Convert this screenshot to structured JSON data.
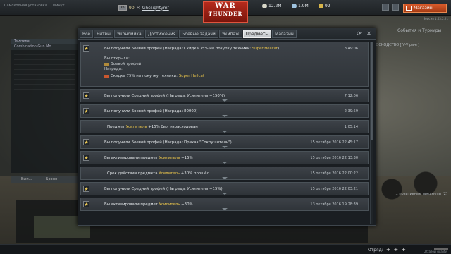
{
  "topbar": {
    "left_info": "Самоходная установка ... Минут ...",
    "player_flag": "XA",
    "player_level": "90",
    "player_name": "Ghcsightymf",
    "logo_line1": "WAR",
    "logo_line2": "THUNDER",
    "silver_lions": "12.2M",
    "research": "1.9M",
    "golden_eagles": "92",
    "store_label": "Магазин",
    "version": "Версия 1.63.2.21"
  },
  "background": {
    "left_panel_title": "Техника",
    "left_panel_sub": "Combination Gun Mo...",
    "left_panel_bottom": "Вып...",
    "left_panel_bottom2": "Броня",
    "right_panel_title": "События и Турниры",
    "right_panel_line": "ВОСКОДСТВО",
    "right_panel_mode": "[IV-V ранг]",
    "right_panel_bottom": "... позитивные предметы (2)"
  },
  "window": {
    "tabs": [
      {
        "label": "Все",
        "active": false
      },
      {
        "label": "Битвы",
        "active": false
      },
      {
        "label": "Экономика",
        "active": false
      },
      {
        "label": "Достижения",
        "active": false
      },
      {
        "label": "Боевые задачи",
        "active": false
      },
      {
        "label": "Экипаж",
        "active": false
      },
      {
        "label": "Предметы",
        "active": true
      },
      {
        "label": "Магазин",
        "active": false
      }
    ],
    "refresh_icon": "refresh-icon",
    "close_icon": "close-icon",
    "rows": [
      {
        "star": true,
        "text_pre": "Вы получили Боевой трофей (Награда: Скидка 75% на покупку техники: ",
        "text_hl": "Super Hellcat",
        "text_post": ")",
        "time": "8:49:06",
        "expanded": true,
        "details": {
          "opened_label": "Вы открыли:",
          "opened_item": "Боевой трофей",
          "reward_label": "Награда:",
          "reward_text": "Скидка 75% на покупку техники: ",
          "reward_hl": "Super Hellcat"
        }
      },
      {
        "star": true,
        "text_pre": "Вы получили Средний трофей (Награда: Усилитель +150%",
        "text_hl": "",
        "text_post": ")",
        "time": "7:12:06",
        "expanded": false
      },
      {
        "star": true,
        "text_pre": "Вы получили Боевой трофей (Награда: 80000",
        "text_hl": "",
        "text_post": ")",
        "time": "2:39:59",
        "expanded": false
      },
      {
        "star": false,
        "text_pre": "Предмет ",
        "text_hl": "Усилитель",
        "text_post": " +15% был израсходован",
        "time": "1:05:14",
        "expanded": false
      },
      {
        "star": true,
        "text_pre": "Вы получили Боевой трофей (Награда: Приказ \"Сокрушитель\")",
        "text_hl": "",
        "text_post": "",
        "time": "15 октября 2016 22:45:17",
        "expanded": false
      },
      {
        "star": true,
        "text_pre": "Вы активировали предмет ",
        "text_hl": "Усилитель",
        "text_post": " +15%",
        "time": "15 октября 2016 22:13:30",
        "expanded": false
      },
      {
        "star": false,
        "text_pre": "Срок действия предмета ",
        "text_hl": "Усилитель",
        "text_post": " +30% прошёл",
        "time": "15 октября 2016 22:00:22",
        "expanded": false
      },
      {
        "star": true,
        "text_pre": "Вы получили Средний трофей (Награда: Усилитель +15%",
        "text_hl": "",
        "text_post": ")",
        "time": "15 октября 2016 22:03:21",
        "expanded": false
      },
      {
        "star": true,
        "text_pre": "Вы активировали предмет ",
        "text_hl": "Усилитель",
        "text_post": " +30%",
        "time": "13 октября 2016 19:28:39",
        "expanded": false
      }
    ]
  },
  "bottombar": {
    "squad_label": "Отряд:",
    "quality_label": "Ultra low quality"
  },
  "colors": {
    "highlight": "#e8c34b",
    "accent_store": "#d85a2a",
    "logo_red": "#b52a1c"
  }
}
